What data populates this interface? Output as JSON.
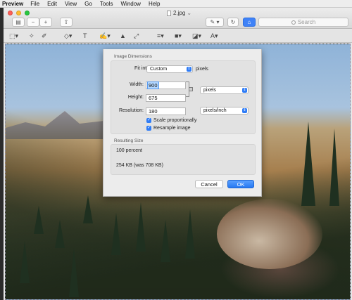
{
  "menubar": {
    "app": "Preview",
    "items": [
      "File",
      "Edit",
      "View",
      "Go",
      "Tools",
      "Window",
      "Help"
    ]
  },
  "window": {
    "title": "2.jpg",
    "title_suffix": "⌄",
    "search_placeholder": "Search"
  },
  "dialog": {
    "image_dimensions_label": "Image Dimensions",
    "fit_into_label": "Fit into:",
    "fit_into_value": "Custom",
    "fit_into_unit": "pixels",
    "width_label": "Width:",
    "width_value": "900",
    "height_label": "Height:",
    "height_value": "675",
    "dimension_unit": "pixels",
    "resolution_label": "Resolution:",
    "resolution_value": "180",
    "resolution_unit": "pixels/inch",
    "scale_label": "Scale proportionally",
    "scale_checked": true,
    "resample_label": "Resample image",
    "resample_checked": true,
    "resulting_size_label": "Resulting Size",
    "percent_text": "100 percent",
    "size_text": "254 KB (was 708 KB)",
    "cancel_label": "Cancel",
    "ok_label": "OK"
  },
  "colors": {
    "accent": "#2f7cf6",
    "close": "#fc5f57",
    "minimize": "#fdbc2e",
    "maximize": "#28c840"
  }
}
